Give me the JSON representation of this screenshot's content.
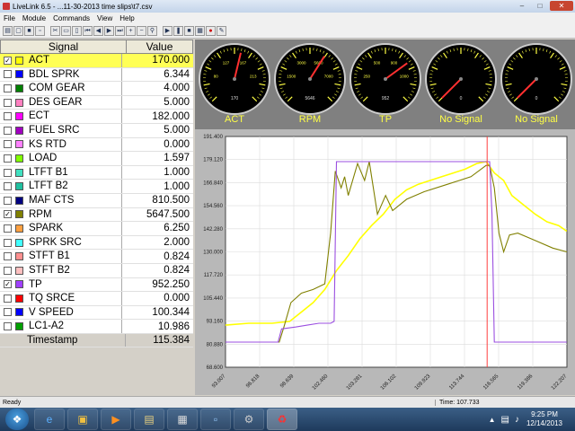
{
  "window": {
    "title": "LiveLink 6.5 - ...11-30-2013 time slips\\t7.csv"
  },
  "menu": [
    "File",
    "Module",
    "Commands",
    "View",
    "Help"
  ],
  "table": {
    "header_signal": "Signal",
    "header_value": "Value",
    "rows": [
      {
        "name": "ACT",
        "value": "170.000",
        "checked": true,
        "color": "#ffff00",
        "highlight": true
      },
      {
        "name": "BDL SPRK",
        "value": "6.344",
        "checked": false,
        "color": "#0000ff"
      },
      {
        "name": "COM GEAR",
        "value": "4.000",
        "checked": false,
        "color": "#008000"
      },
      {
        "name": "DES GEAR",
        "value": "5.000",
        "checked": false,
        "color": "#ff80c0"
      },
      {
        "name": "ECT",
        "value": "182.000",
        "checked": false,
        "color": "#ff00ff"
      },
      {
        "name": "FUEL SRC",
        "value": "5.000",
        "checked": false,
        "color": "#a000c0"
      },
      {
        "name": "KS RTD",
        "value": "0.000",
        "checked": false,
        "color": "#ff80ff"
      },
      {
        "name": "LOAD",
        "value": "1.597",
        "checked": false,
        "color": "#80ff00"
      },
      {
        "name": "LTFT B1",
        "value": "1.000",
        "checked": false,
        "color": "#40e0c0"
      },
      {
        "name": "LTFT B2",
        "value": "1.000",
        "checked": false,
        "color": "#20c0a0"
      },
      {
        "name": "MAF CTS",
        "value": "810.500",
        "checked": false,
        "color": "#000080"
      },
      {
        "name": "RPM",
        "value": "5647.500",
        "checked": true,
        "color": "#808000"
      },
      {
        "name": "SPARK",
        "value": "6.250",
        "checked": false,
        "color": "#ffa040"
      },
      {
        "name": "SPRK SRC",
        "value": "2.000",
        "checked": false,
        "color": "#40ffff"
      },
      {
        "name": "STFT B1",
        "value": "0.824",
        "checked": false,
        "color": "#ff9090"
      },
      {
        "name": "STFT B2",
        "value": "0.824",
        "checked": false,
        "color": "#ffc0c0"
      },
      {
        "name": "TP",
        "value": "952.250",
        "checked": true,
        "color": "#a040ff"
      },
      {
        "name": "TQ SRCE",
        "value": "0.000",
        "checked": false,
        "color": "#ff0000"
      },
      {
        "name": "V SPEED",
        "value": "100.344",
        "checked": false,
        "color": "#0000ff"
      },
      {
        "name": "LC1-A2",
        "value": "10.986",
        "checked": false,
        "color": "#00a000"
      }
    ],
    "timestamp_label": "Timestamp",
    "timestamp_value": "115.384"
  },
  "gauges": [
    {
      "label": "ACT",
      "readout": "170",
      "needle": 0.55,
      "ticks": [
        "80",
        "127",
        "167",
        "213"
      ]
    },
    {
      "label": "RPM",
      "readout": "5646",
      "needle": 0.62,
      "ticks": [
        "1500",
        "3000",
        "5600",
        "7000"
      ]
    },
    {
      "label": "TP",
      "readout": "952",
      "needle": 0.7,
      "ticks": [
        "250",
        "500",
        "900",
        "1000"
      ]
    },
    {
      "label": "No Signal",
      "readout": "0",
      "needle": -0.15,
      "ticks": [
        "",
        "",
        "",
        ""
      ]
    },
    {
      "label": "No Signal",
      "readout": "0",
      "needle": -0.15,
      "ticks": [
        "",
        "",
        "",
        ""
      ]
    }
  ],
  "chart_data": {
    "type": "line",
    "yticks": [
      "191.400",
      "179.120",
      "166.840",
      "154.560",
      "142.280",
      "130.000",
      "117.720",
      "105.440",
      "93.160",
      "80.880",
      "68.600"
    ],
    "ylim": [
      68.6,
      191.4
    ],
    "xticks": [
      "93.007",
      "96.818",
      "98.639",
      "102.460",
      "103.281",
      "106.102",
      "109.923",
      "113.744",
      "116.565",
      "119.386",
      "122.207"
    ],
    "xlim": [
      93.007,
      122.207
    ],
    "cursor_x": 115.384,
    "series": [
      {
        "color": "#ffff00",
        "x": [
          93.0,
          95.0,
          97.0,
          98.5,
          99.5,
          100.5,
          101.5,
          102.5,
          103.5,
          104.5,
          105.5,
          106.5,
          107.5,
          108.5,
          109.5,
          110.5,
          111.5,
          112.5,
          113.5,
          114.5,
          115.3,
          116.0,
          116.8,
          117.5,
          118.5,
          119.5,
          120.5,
          121.5,
          122.2
        ],
        "y": [
          91,
          92,
          92,
          93,
          98,
          103,
          110,
          120,
          128,
          137,
          144,
          150,
          158,
          163,
          166,
          168,
          170,
          172,
          174,
          177,
          178,
          172,
          168,
          160,
          155,
          150,
          146,
          144,
          141
        ]
      },
      {
        "color": "#808000",
        "x": [
          93.0,
          96.0,
          97.6,
          98.0,
          98.6,
          99.5,
          100.5,
          101.5,
          102.0,
          102.4,
          102.9,
          103.2,
          103.5,
          104.3,
          104.9,
          105.3,
          106.0,
          106.7,
          107.3,
          108.5,
          110.0,
          112.0,
          114.0,
          115.3,
          115.6,
          116.0,
          116.4,
          116.8,
          117.3,
          118.0,
          119.5,
          121.0,
          122.2
        ],
        "y": [
          82,
          82,
          82,
          90,
          103,
          108,
          110,
          113,
          140,
          173,
          164,
          170,
          160,
          177,
          168,
          178,
          150,
          160,
          152,
          158,
          162,
          166,
          170,
          176,
          176,
          164,
          140,
          130,
          139,
          140,
          136,
          132,
          130
        ]
      },
      {
        "color": "#9b4fe0",
        "x": [
          93.0,
          97.5,
          97.8,
          99.0,
          100.0,
          101.0,
          102.0,
          102.3,
          102.5,
          104.0,
          106.0,
          108.0,
          110.0,
          112.0,
          114.0,
          115.6,
          115.8,
          116.0,
          117.0,
          119.0,
          122.2
        ],
        "y": [
          82,
          82,
          89,
          90,
          91,
          92,
          92,
          93,
          178,
          178,
          178,
          178,
          178,
          178,
          178,
          178,
          150,
          82,
          82,
          82,
          82
        ]
      }
    ]
  },
  "status": {
    "left": "Ready",
    "right": "Time: 107.733"
  },
  "taskbar": {
    "time": "9:25 PM",
    "date": "12/14/2013"
  },
  "colors": {
    "plot_bg": "#ffffff",
    "gauge_face": "#000000",
    "gauge_text": "#ffff44",
    "needle": "#ff3030",
    "cursor": "#ff4040"
  }
}
